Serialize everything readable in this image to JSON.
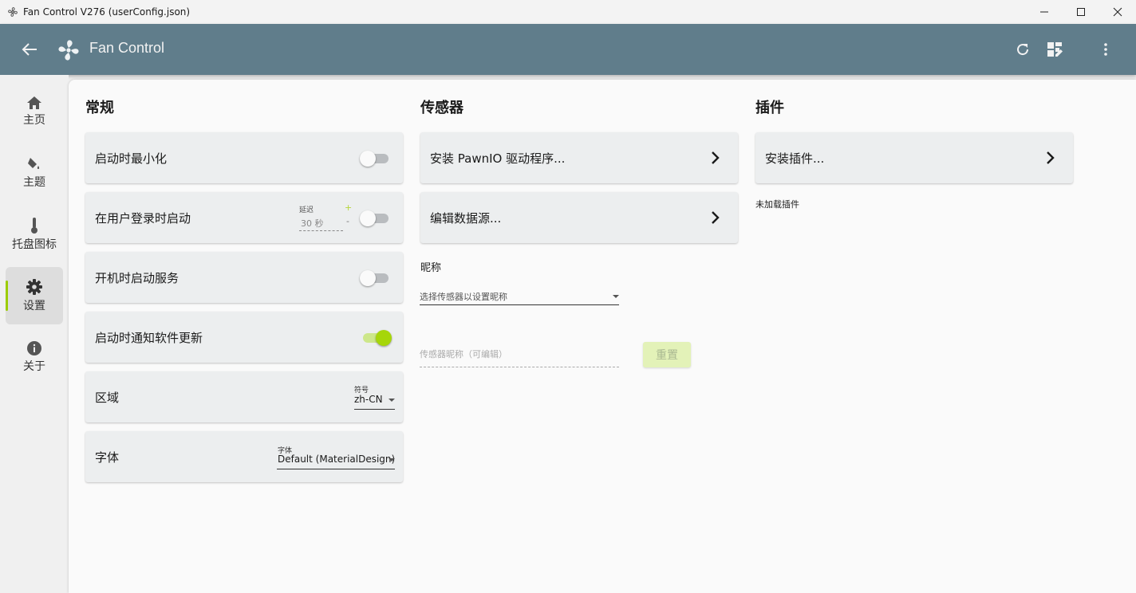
{
  "window": {
    "title": "Fan Control V276 (userConfig.json)",
    "icons": [
      "app-fan-icon",
      "minimize-icon",
      "maximize-icon",
      "close-icon"
    ]
  },
  "appbar": {
    "title": "Fan Control",
    "icons": [
      "back-arrow-icon",
      "fan-logo-icon",
      "refresh-icon",
      "dashboard-edit-icon",
      "more-vert-icon"
    ],
    "background": "#607d8b"
  },
  "sidebar": {
    "items": [
      {
        "label": "主页",
        "icon": "home-icon"
      },
      {
        "label": "主题",
        "icon": "paint-bucket-icon"
      },
      {
        "label": "托盘图标",
        "icon": "thermometer-icon"
      },
      {
        "label": "设置",
        "icon": "gear-icon",
        "active": true
      },
      {
        "label": "关于",
        "icon": "info-icon"
      }
    ],
    "accent": "#9ccc00"
  },
  "general": {
    "title": "常规",
    "minimize_on_start": {
      "label": "启动时最小化",
      "enabled": false
    },
    "start_on_login": {
      "label": "在用户登录时启动",
      "enabled": false,
      "delay_label": "延迟",
      "delay_value": "30 秒",
      "plus": "+",
      "minus": "-"
    },
    "start_service_on_boot": {
      "label": "开机时启动服务",
      "enabled": false
    },
    "notify_updates": {
      "label": "启动时通知软件更新",
      "enabled": true
    },
    "region": {
      "label": "区域",
      "combo_label": "符号",
      "value": "zh-CN"
    },
    "font": {
      "label": "字体",
      "combo_label": "字体",
      "value": "Default (MaterialDesign)"
    }
  },
  "sensors": {
    "title": "传感器",
    "install_pawnio": "安装 PawnIO 驱动程序...",
    "edit_sources": "编辑数据源...",
    "nickname_label": "昵称",
    "select_placeholder": "选择传感器以设置昵称",
    "nickname_placeholder": "传感器昵称（可编辑）",
    "reset_button": "重置"
  },
  "plugins": {
    "title": "插件",
    "install_plugins": "安装插件...",
    "none_loaded": "未加载插件"
  },
  "colors": {
    "accent": "#a6d60a",
    "card_bg": "#eceeef"
  }
}
